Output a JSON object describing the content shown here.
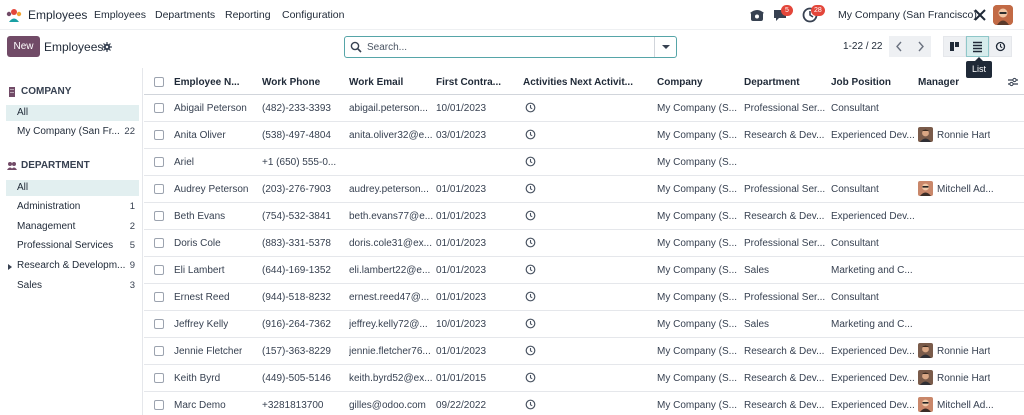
{
  "app": {
    "name": "Employees"
  },
  "menu": [
    {
      "label": "Employees",
      "key": "employees"
    },
    {
      "label": "Departments",
      "key": "departments"
    },
    {
      "label": "Reporting",
      "key": "reporting"
    },
    {
      "label": "Configuration",
      "key": "configuration"
    }
  ],
  "systray": {
    "messages_count": "5",
    "activities_count": "28",
    "company": "My Company (San Francisco)"
  },
  "control": {
    "new_label": "New",
    "title": "Employees",
    "search_placeholder": "Search...",
    "pager": "1-22 / 22",
    "tooltip": "List"
  },
  "sidebar": {
    "company_header": "COMPANY",
    "company_items": [
      {
        "label": "All",
        "count": ""
      },
      {
        "label": "My Company (San Fr...",
        "count": "22"
      }
    ],
    "department_header": "DEPARTMENT",
    "department_items": [
      {
        "label": "All",
        "count": ""
      },
      {
        "label": "Administration",
        "count": "1"
      },
      {
        "label": "Management",
        "count": "2"
      },
      {
        "label": "Professional Services",
        "count": "5"
      },
      {
        "label": "Research & Developm...",
        "count": "9"
      },
      {
        "label": "Sales",
        "count": "3"
      }
    ]
  },
  "table": {
    "columns": [
      "Employee N...",
      "Work Phone",
      "Work Email",
      "First Contra...",
      "Activities",
      "Next Activit...",
      "Company",
      "Department",
      "Job Position",
      "Manager"
    ],
    "rows": [
      {
        "name": "Abigail Peterson",
        "phone": "(482)-233-3393",
        "email": "abigail.peterson...",
        "contract": "10/01/2023",
        "company": "My Company (S...",
        "department": "Professional Ser...",
        "job": "Consultant",
        "manager": ""
      },
      {
        "name": "Anita Oliver",
        "phone": "(538)-497-4804",
        "email": "anita.oliver32@e...",
        "contract": "03/01/2023",
        "company": "My Company (S...",
        "department": "Research & Dev...",
        "job": "Experienced Dev...",
        "manager": "Ronnie Hart"
      },
      {
        "name": "Ariel",
        "phone": "+1 (650) 555-0...",
        "email": "",
        "contract": "",
        "company": "My Company (S...",
        "department": "",
        "job": "",
        "manager": ""
      },
      {
        "name": "Audrey Peterson",
        "phone": "(203)-276-7903",
        "email": "audrey.peterson...",
        "contract": "01/01/2023",
        "company": "My Company (S...",
        "department": "Professional Ser...",
        "job": "Consultant",
        "manager": "Mitchell Ad..."
      },
      {
        "name": "Beth Evans",
        "phone": "(754)-532-3841",
        "email": "beth.evans77@e...",
        "contract": "01/01/2023",
        "company": "My Company (S...",
        "department": "Research & Dev...",
        "job": "Experienced Dev...",
        "manager": ""
      },
      {
        "name": "Doris Cole",
        "phone": "(883)-331-5378",
        "email": "doris.cole31@ex...",
        "contract": "01/01/2023",
        "company": "My Company (S...",
        "department": "Professional Ser...",
        "job": "Consultant",
        "manager": ""
      },
      {
        "name": "Eli Lambert",
        "phone": "(644)-169-1352",
        "email": "eli.lambert22@e...",
        "contract": "01/01/2023",
        "company": "My Company (S...",
        "department": "Sales",
        "job": "Marketing and C...",
        "manager": ""
      },
      {
        "name": "Ernest Reed",
        "phone": "(944)-518-8232",
        "email": "ernest.reed47@...",
        "contract": "01/01/2023",
        "company": "My Company (S...",
        "department": "Professional Ser...",
        "job": "Consultant",
        "manager": ""
      },
      {
        "name": "Jeffrey Kelly",
        "phone": "(916)-264-7362",
        "email": "jeffrey.kelly72@...",
        "contract": "10/01/2023",
        "company": "My Company (S...",
        "department": "Sales",
        "job": "Marketing and C...",
        "manager": ""
      },
      {
        "name": "Jennie Fletcher",
        "phone": "(157)-363-8229",
        "email": "jennie.fletcher76...",
        "contract": "01/01/2023",
        "company": "My Company (S...",
        "department": "Research & Dev...",
        "job": "Experienced Dev...",
        "manager": "Ronnie Hart"
      },
      {
        "name": "Keith Byrd",
        "phone": "(449)-505-5146",
        "email": "keith.byrd52@ex...",
        "contract": "01/01/2015",
        "company": "My Company (S...",
        "department": "Research & Dev...",
        "job": "Experienced Dev...",
        "manager": "Ronnie Hart"
      },
      {
        "name": "Marc Demo",
        "phone": "+3281813700",
        "email": "gilles@odoo.com",
        "contract": "09/22/2022",
        "company": "My Company (S...",
        "department": "Research & Dev...",
        "job": "Experienced Dev...",
        "manager": "Mitchell Ad..."
      }
    ]
  },
  "colors": {
    "brand": "#714b67",
    "accent": "#56a5a8",
    "badge": "#e3463a"
  }
}
